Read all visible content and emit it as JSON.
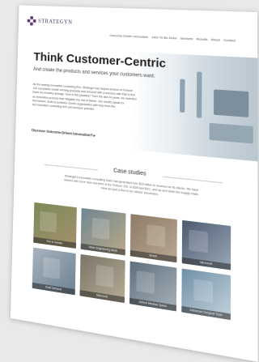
{
  "brand": {
    "name": "STRATEGYN"
  },
  "nav": {
    "items": [
      "Outcome-Driven Innovation",
      "Jobs-To-Be-Done",
      "Services",
      "Results",
      "About",
      "Contact"
    ]
  },
  "hero": {
    "title": "Think Customer-Centric",
    "subtitle": "And create the products and services your customers want.",
    "body": [
      "As the leading innovation consulting firm, Strategyn has helped dozens of Fortune",
      "100 companies create winning products and services with a success rate that is five",
      "times the industry average. How is this possible? Over the last 24 years, we invented",
      "an innovation process that mitigates the risk of failure. Our results speak for",
      "themselves. Build a customer-centric organization with help from the",
      "top innovation consulting firm and services provider."
    ],
    "cta": "Discover Outcome-Driven Innovation® ▸"
  },
  "case_studies": {
    "title": "Case studies",
    "intro": [
      "Strategyn's innovation consulting team has generated over $15 billion in revenue for its clients. We have",
      "worked with more than one-third of the Fortune 100, in B2B and B2C, and up and down the supply chain.",
      "Here are just a few of our clients' successes."
    ],
    "tiles": [
      {
        "caption": "Kim & Hardee",
        "colors": [
          "#7b8a5a",
          "#a4906a"
        ]
      },
      {
        "caption": "Value Engineering Work",
        "colors": [
          "#6f8793",
          "#b9a888"
        ]
      },
      {
        "caption": "Bosch",
        "colors": [
          "#8f7b66",
          "#b8a792"
        ]
      },
      {
        "caption": "Microsoft",
        "colors": [
          "#4b5a70",
          "#9ba8b8"
        ]
      },
      {
        "caption": "Kraft Grimaud",
        "colors": [
          "#a7b3bd",
          "#6d8292"
        ]
      },
      {
        "caption": "Microsoft",
        "colors": [
          "#7a7466",
          "#b6ac96"
        ]
      },
      {
        "caption": "Abbott Medical Optics",
        "colors": [
          "#5d6e7d",
          "#a8b3ba"
        ]
      },
      {
        "caption": "Advanced Surgical Tools",
        "colors": [
          "#6f8fa6",
          "#c5d3dc"
        ]
      }
    ]
  }
}
